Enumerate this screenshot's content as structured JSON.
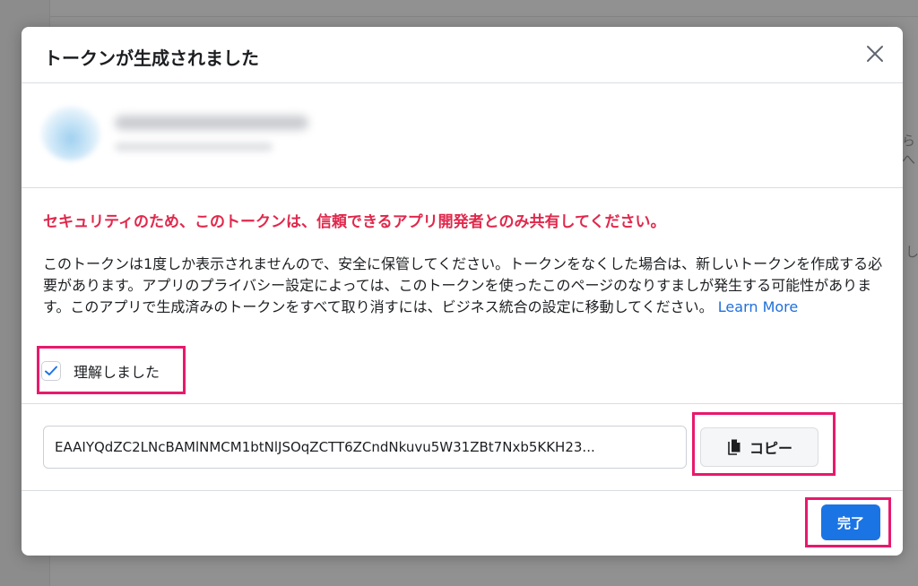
{
  "background": {
    "peek_text_1": "らへ",
    "peek_text_2": "し"
  },
  "modal": {
    "title": "トークンが生成されました",
    "warning": "セキュリティのため、このトークンは、信頼できるアプリ開発者とのみ共有してください。",
    "description": "このトークンは1度しか表示されませんので、安全に保管してください。トークンをなくした場合は、新しいトークンを作成する必要があります。アプリのプライバシー設定によっては、このトークンを使ったこのページのなりすましが発生する可能性があります。このアプリで生成済みのトークンをすべて取り消すには、ビジネス統合の設定に移動してください。",
    "learn_more": "Learn More",
    "acknowledge": {
      "label": "理解しました",
      "checked": true
    },
    "token": {
      "value": "EAAIYQdZC2LNcBAMlNMCM1btNlJSOqZCTT6ZCndNkuvu5W31ZBt7Nxb5KKH23..."
    },
    "copy_label": "コピー",
    "done_label": "完了"
  },
  "colors": {
    "warning": "#e0284c",
    "primary": "#1b74e4",
    "link": "#216fdb",
    "highlight": "#e8196c"
  },
  "icons": {
    "close": "close-icon",
    "check": "checkmark-icon",
    "copy": "copy-icon"
  }
}
